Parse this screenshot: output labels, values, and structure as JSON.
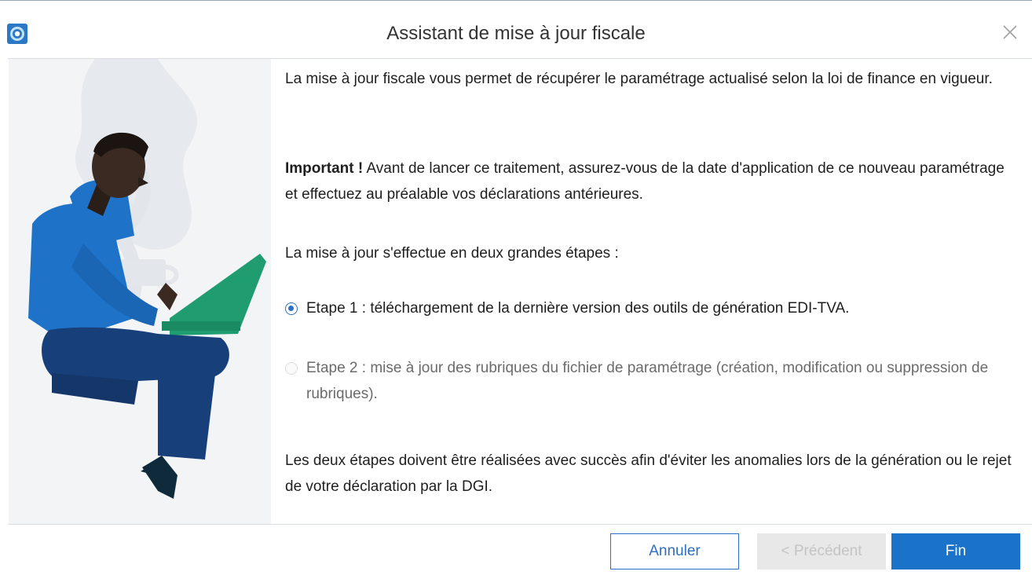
{
  "window": {
    "title": "Assistant de mise à jour fiscale"
  },
  "content": {
    "intro": "La mise à jour fiscale vous permet de récupérer le paramétrage actualisé selon la loi de finance en vigueur.",
    "important_label": "Important !",
    "important_text": " Avant de lancer ce traitement, assurez-vous de la date d'application de ce nouveau paramétrage et effectuez au préalable vos déclarations antérieures.",
    "steps_intro": "La mise à jour s'effectue en deux grandes étapes :",
    "steps": [
      {
        "label": "Etape 1 : téléchargement de la dernière version des outils de génération EDI-TVA.",
        "checked": true,
        "enabled": true
      },
      {
        "label": "Etape 2 : mise à jour des rubriques du fichier de paramétrage (création, modification ou suppression de rubriques).",
        "checked": false,
        "enabled": false
      }
    ],
    "conclusion": "Les deux étapes doivent être réalisées avec succès afin d'éviter les anomalies lors de la génération ou le rejet de votre déclaration par la DGI."
  },
  "footer": {
    "cancel_label": "Annuler",
    "previous_label": "< Précédent",
    "finish_label": "Fin"
  },
  "colors": {
    "accent": "#1a73c8",
    "illustration_shirt": "#1e73c8",
    "illustration_laptop": "#1f9c70",
    "illustration_pants": "#173f7a"
  },
  "icons": {
    "app": "app-logo-icon",
    "close": "close-icon"
  }
}
